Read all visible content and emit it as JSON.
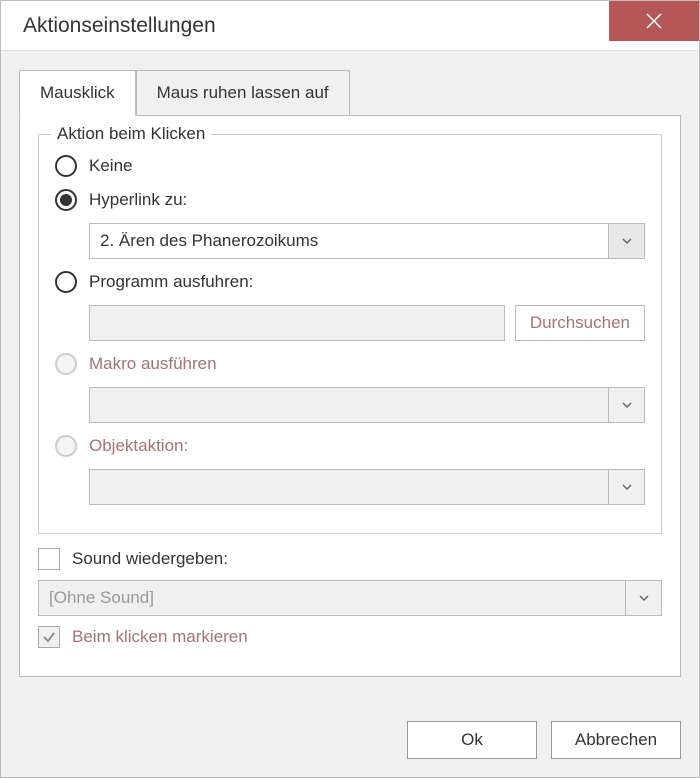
{
  "window": {
    "title": "Aktionseinstellungen"
  },
  "tabs": {
    "click": "Mausklick",
    "hover": "Maus ruhen lassen auf"
  },
  "groupbox": {
    "legend": "Aktion beim Klicken"
  },
  "actions": {
    "none": "Keine",
    "hyperlink": "Hyperlink zu:",
    "hyperlink_value": "2. Ären des Phanerozoikums",
    "run_program": "Programm ausfuhren:",
    "browse": "Durchsuchen",
    "run_macro": "Makro ausführen",
    "object_action": "Objektaktion:"
  },
  "sound": {
    "play": "Sound wiedergeben:",
    "value": "[Ohne Sound]",
    "highlight": "Beim klicken markieren"
  },
  "buttons": {
    "ok": "Ok",
    "cancel": "Abbrechen"
  }
}
